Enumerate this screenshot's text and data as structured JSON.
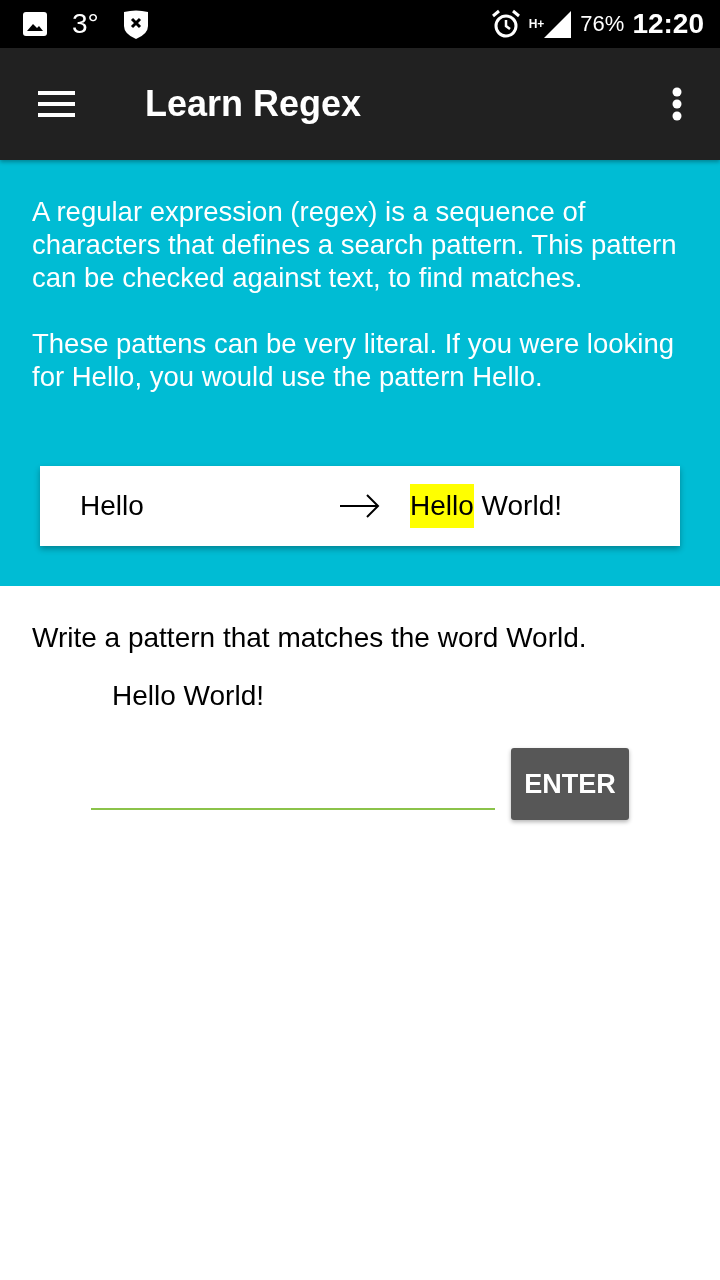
{
  "status_bar": {
    "temperature": "3°",
    "network_type": "H+",
    "battery": "76%",
    "time": "12:20"
  },
  "app_bar": {
    "title": "Learn Regex"
  },
  "intro": {
    "paragraphs": [
      "A regular expression (regex) is a sequence of characters that defines a search pattern. This pattern can be checked against text, to find matches.",
      "These pattens can be very literal. If you were looking for Hello, you would use the pattern Hello."
    ],
    "example": {
      "pattern": "Hello",
      "result": [
        {
          "text": "Hello",
          "highlighted": true
        },
        {
          "text": " World!",
          "highlighted": false
        }
      ]
    }
  },
  "exercise": {
    "prompt": "Write a pattern that matches the word World.",
    "subject": "Hello World!",
    "button": "ENTER"
  }
}
